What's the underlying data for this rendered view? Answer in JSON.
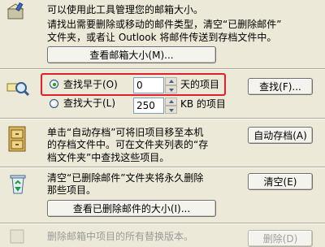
{
  "mailbox_section": {
    "line1": "可以使用此工具管理您的邮箱大小。",
    "line2": "请找出需要删除或移动的邮件类型，清空“已删除邮件”",
    "line3": "文件夹，或者让 Outlook 将邮件传送到存档文件中。",
    "view_size_button": "查看邮箱大小(M)..."
  },
  "find_section": {
    "older_label": "查找早于(O)",
    "older_value": "0",
    "older_unit": "天的项目",
    "larger_label": "查找大于(L)",
    "larger_value": "250",
    "larger_unit": "KB 的项目",
    "find_button": "查找(F)..."
  },
  "archive_section": {
    "line1": "单击“自动存档”可将旧项目移至本机",
    "line2": "的存档文件中。可在文件夹列表的“存",
    "line3": "档文件夹”中查找这些项目。",
    "autoarchive_button": "自动存档(A)"
  },
  "deleted_section": {
    "line1": "清空“已删除邮件”文件夹将永久删除",
    "line2": "那些项目。",
    "empty_button": "清空(E)",
    "view_size_button": "查看已删除邮件的大小(I)..."
  },
  "versions_section": {
    "line1": "删除邮箱中项目的所有替换版本。",
    "delete_button": "删除(D)"
  },
  "colors": {
    "background": "#ece9d8",
    "highlight": "#e0202a"
  }
}
